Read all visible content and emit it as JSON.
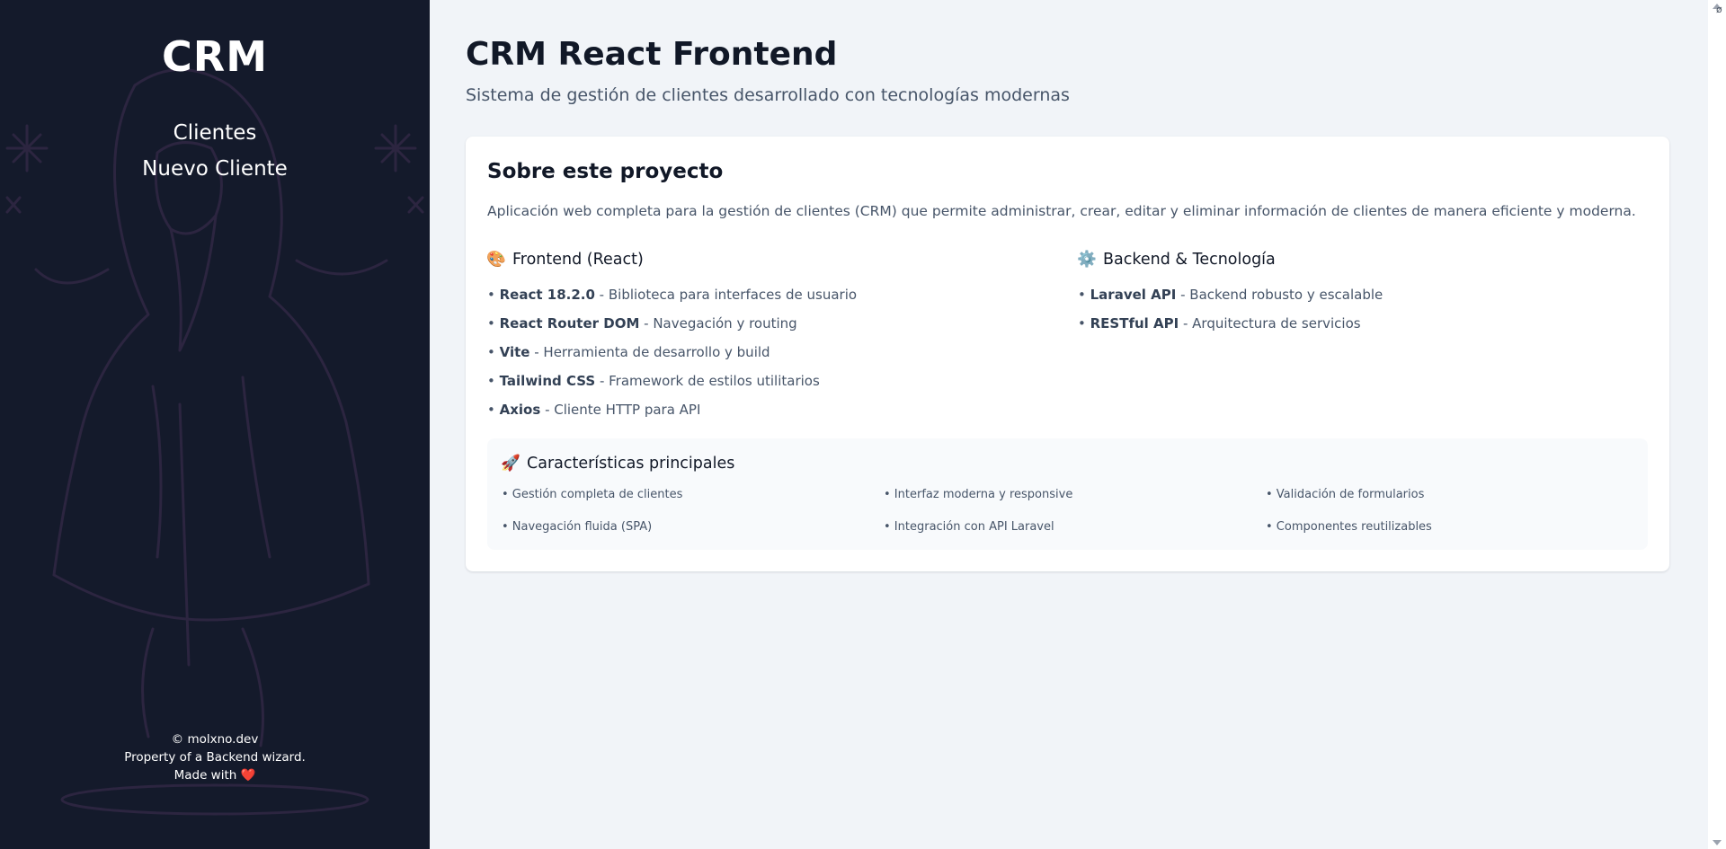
{
  "sidebar": {
    "brand": "CRM",
    "nav": [
      {
        "label": "Clientes"
      },
      {
        "label": "Nuevo Cliente"
      }
    ],
    "footer": {
      "line1": "© molxno.dev",
      "line2": "Property of a Backend wizard.",
      "line3": "Made with",
      "heart": "❤️"
    }
  },
  "header": {
    "title": "CRM React Frontend",
    "subtitle": "Sistema de gestión de clientes desarrollado con tecnologías modernas"
  },
  "about": {
    "title": "Sobre este proyecto",
    "description": "Aplicación web completa para la gestión de clientes (CRM) que permite administrar, crear, editar y eliminar información de clientes de manera eficiente y moderna.",
    "frontend": {
      "icon": "palette-icon",
      "emoji": "🎨",
      "title": "Frontend (React)",
      "items": [
        {
          "name": "React 18.2.0",
          "desc": " - Biblioteca para interfaces de usuario"
        },
        {
          "name": "React Router DOM",
          "desc": " - Navegación y routing"
        },
        {
          "name": "Vite",
          "desc": " - Herramienta de desarrollo y build"
        },
        {
          "name": "Tailwind CSS",
          "desc": " - Framework de estilos utilitarios"
        },
        {
          "name": "Axios",
          "desc": " - Cliente HTTP para API"
        }
      ]
    },
    "backend": {
      "icon": "gear-icon",
      "emoji": "⚙️",
      "title": "Backend & Tecnología",
      "items": [
        {
          "name": "Laravel API",
          "desc": " - Backend robusto y escalable"
        },
        {
          "name": "RESTful API",
          "desc": " - Arquitectura de servicios"
        }
      ]
    },
    "features": {
      "icon": "rocket-icon",
      "emoji": "🚀",
      "title": "Características principales",
      "items": [
        "• Gestión completa de clientes",
        "• Interfaz moderna y responsive",
        "• Validación de formularios",
        "• Navegación fluida (SPA)",
        "• Integración con API Laravel",
        "• Componentes reutilizables"
      ]
    }
  },
  "bullet": "• ",
  "corner_glyph": "ø",
  "colors": {
    "sidebar_bg": "#141a2b",
    "main_bg": "#f1f4f8",
    "card_bg": "#ffffff",
    "heart": "#e11d48"
  }
}
